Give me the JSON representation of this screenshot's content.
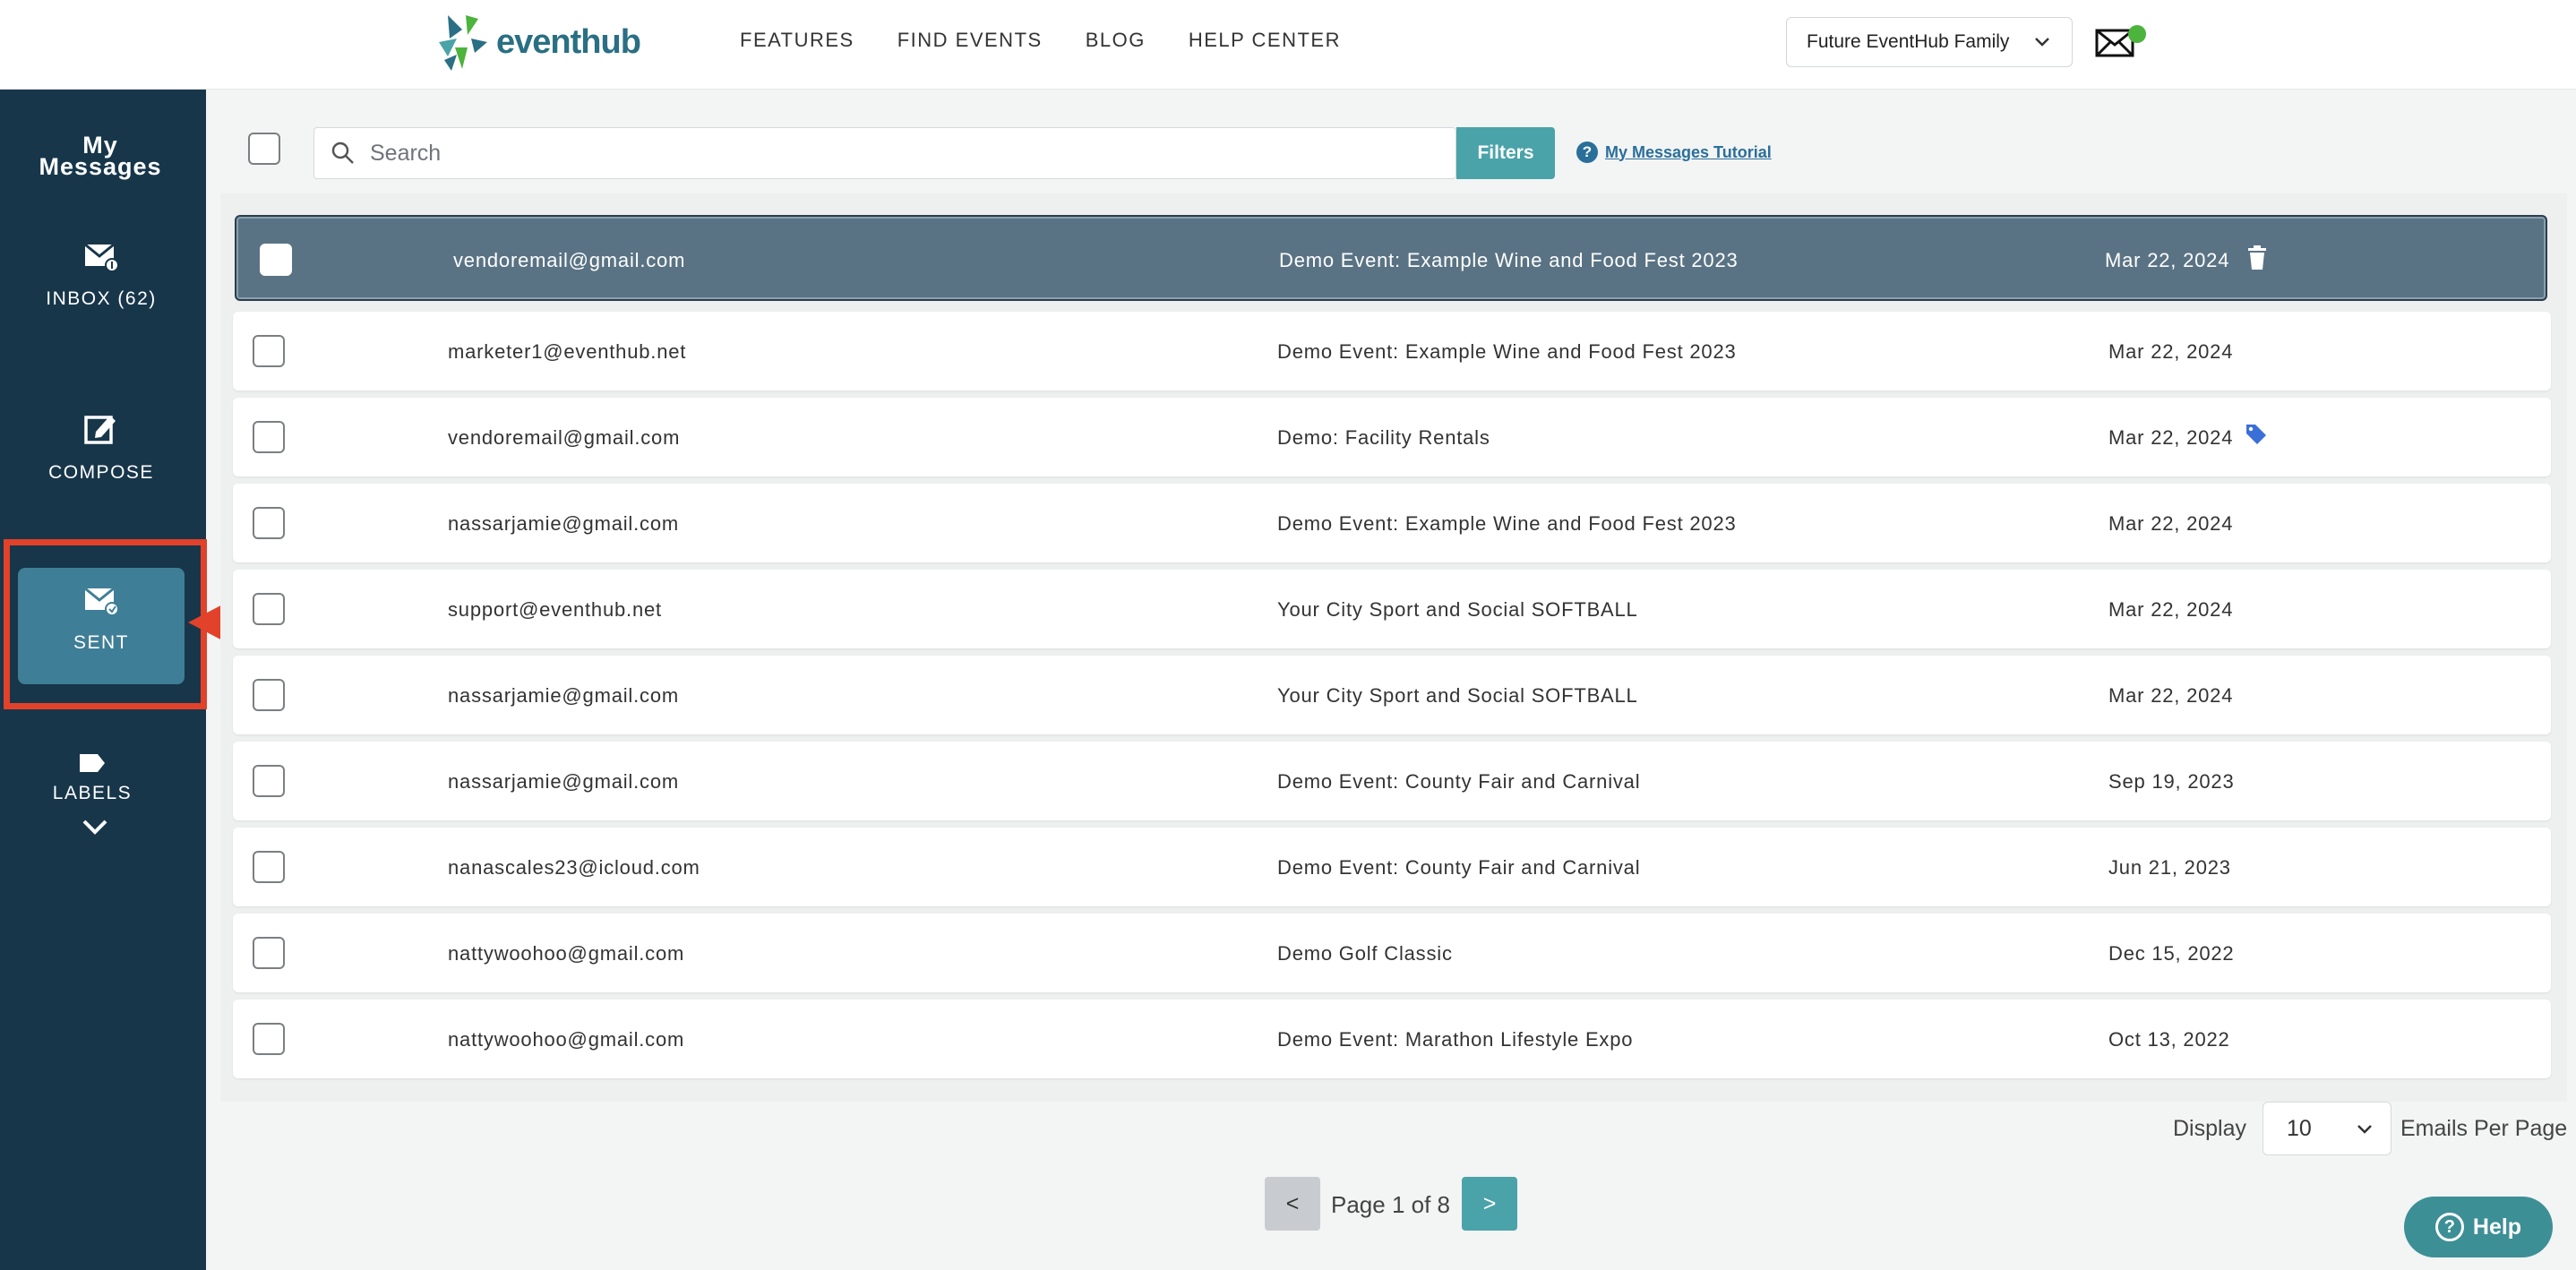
{
  "brand": {
    "name": "eventhub"
  },
  "nav": {
    "items": [
      "FEATURES",
      "FIND EVENTS",
      "BLOG",
      "HELP CENTER"
    ]
  },
  "account": {
    "name": "Future EventHub Family"
  },
  "sidebar": {
    "title_line1": "My",
    "title_line2": "Messages",
    "inbox": "INBOX (62)",
    "compose": "COMPOSE",
    "sent": "SENT",
    "labels": "LABELS"
  },
  "toolbar": {
    "search_placeholder": "Search",
    "filters": "Filters",
    "tutorial": "My Messages Tutorial"
  },
  "messages": [
    {
      "from": "vendoremail@gmail.com",
      "subject": "Demo Event: Example Wine and Food Fest 2023",
      "date": "Mar 22, 2024"
    },
    {
      "from": "marketer1@eventhub.net",
      "subject": "Demo Event: Example Wine and Food Fest 2023",
      "date": "Mar 22, 2024"
    },
    {
      "from": "vendoremail@gmail.com",
      "subject": "Demo: Facility Rentals",
      "date": "Mar 22, 2024"
    },
    {
      "from": "nassarjamie@gmail.com",
      "subject": "Demo Event: Example Wine and Food Fest 2023",
      "date": "Mar 22, 2024"
    },
    {
      "from": "support@eventhub.net",
      "subject": "Your City Sport and Social SOFTBALL",
      "date": "Mar 22, 2024"
    },
    {
      "from": "nassarjamie@gmail.com",
      "subject": "Your City Sport and Social SOFTBALL",
      "date": "Mar 22, 2024"
    },
    {
      "from": "nassarjamie@gmail.com",
      "subject": "Demo Event: County Fair and Carnival",
      "date": "Sep 19, 2023"
    },
    {
      "from": "nanascales23@icloud.com",
      "subject": "Demo Event: County Fair and Carnival",
      "date": "Jun 21, 2023"
    },
    {
      "from": "nattywoohoo@gmail.com",
      "subject": "Demo Golf Classic",
      "date": "Dec 15, 2022"
    },
    {
      "from": "nattywoohoo@gmail.com",
      "subject": "Demo Event: Marathon Lifestyle Expo",
      "date": "Oct 13, 2022"
    }
  ],
  "footer": {
    "display_label": "Display",
    "display_value": "10",
    "per_page_label": "Emails Per Page",
    "prev": "<",
    "page_text": "Page 1 of 8",
    "next": ">",
    "help": "Help"
  },
  "colors": {
    "sidebar": "#17364a",
    "accent": "#4aa3a9",
    "selected_row": "#5a7384",
    "highlight": "#e2412a"
  }
}
